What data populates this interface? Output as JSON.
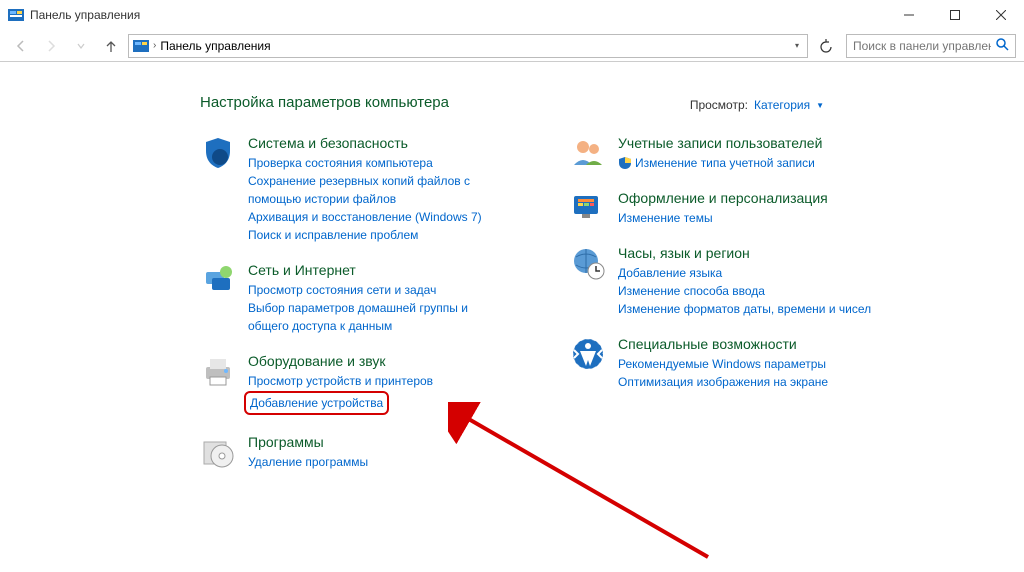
{
  "window_title": "Панель управления",
  "address_path": "Панель управления",
  "search_placeholder": "Поиск в панели управления",
  "page_heading": "Настройка параметров компьютера",
  "view_by": {
    "label": "Просмотр:",
    "value": "Категория"
  },
  "categories": {
    "system": {
      "title": "Система и безопасность",
      "links": [
        "Проверка состояния компьютера",
        "Сохранение резервных копий файлов с помощью истории файлов",
        "Архивация и восстановление (Windows 7)",
        "Поиск и исправление проблем"
      ]
    },
    "network": {
      "title": "Сеть и Интернет",
      "links": [
        "Просмотр состояния сети и задач",
        "Выбор параметров домашней группы и общего доступа к данным"
      ]
    },
    "hardware": {
      "title": "Оборудование и звук",
      "links": [
        "Просмотр устройств и принтеров",
        "Добавление устройства"
      ]
    },
    "programs": {
      "title": "Программы",
      "links": [
        "Удаление программы"
      ]
    },
    "accounts": {
      "title": "Учетные записи пользователей",
      "links": [
        "Изменение типа учетной записи"
      ]
    },
    "appearance": {
      "title": "Оформление и персонализация",
      "links": [
        "Изменение темы"
      ]
    },
    "clock": {
      "title": "Часы, язык и регион",
      "links": [
        "Добавление языка",
        "Изменение способа ввода",
        "Изменение форматов даты, времени и чисел"
      ]
    },
    "ease": {
      "title": "Специальные возможности",
      "links": [
        "Рекомендуемые Windows параметры",
        "Оптимизация изображения на экране"
      ]
    }
  }
}
